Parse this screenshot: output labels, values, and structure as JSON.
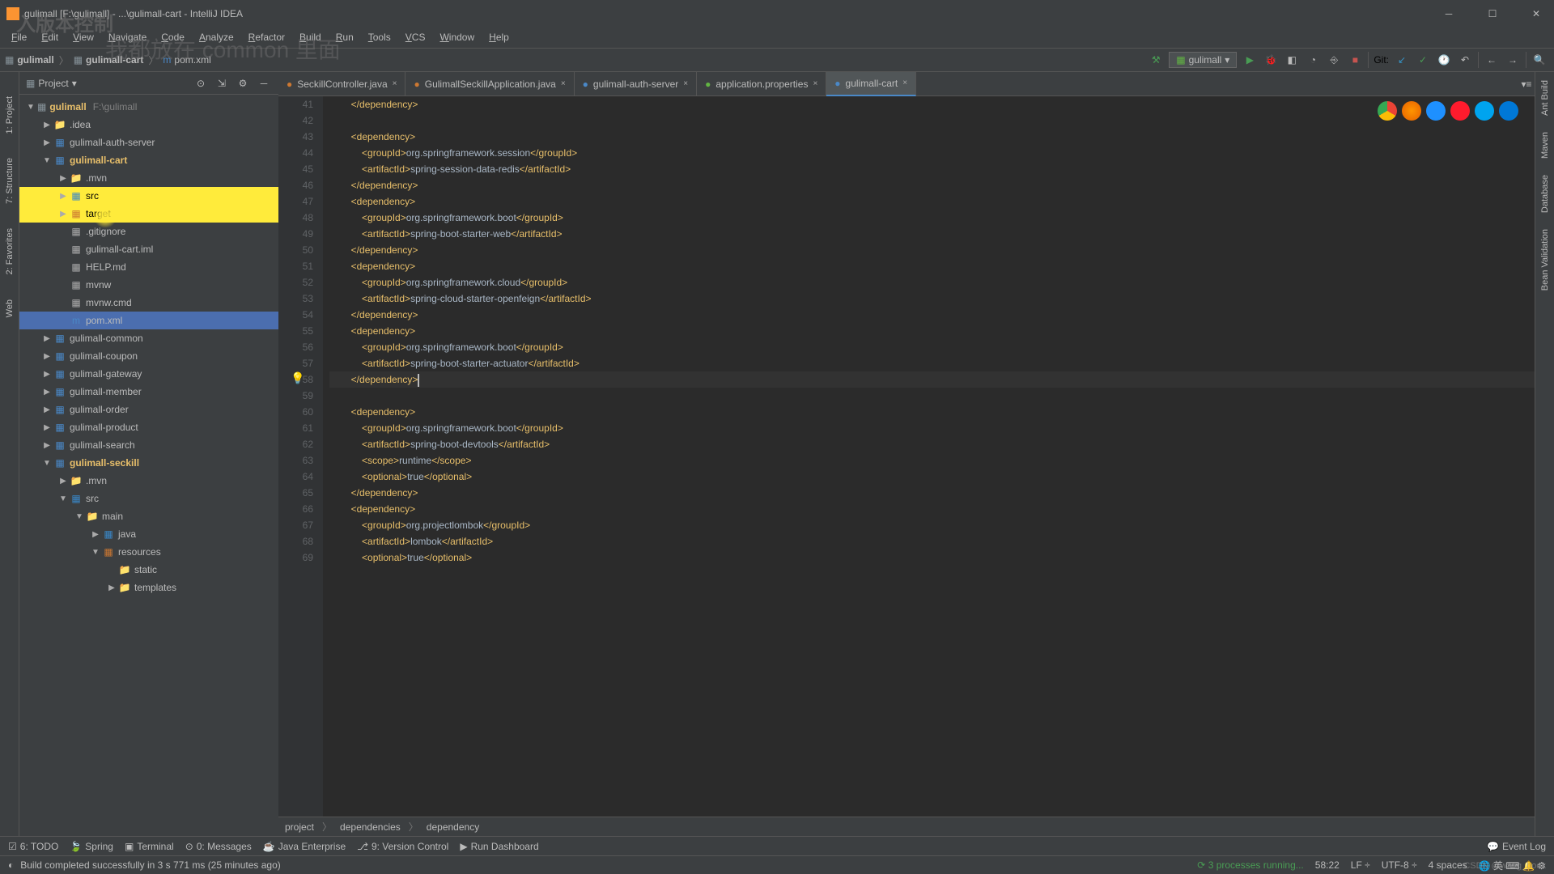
{
  "watermark1": "入版本控制",
  "watermark2": "我都放在 common 里面",
  "title": "gulimall [F:\\gulimall] - ...\\gulimall-cart - IntelliJ IDEA",
  "menu": [
    "File",
    "Edit",
    "View",
    "Navigate",
    "Code",
    "Analyze",
    "Refactor",
    "Build",
    "Run",
    "Tools",
    "VCS",
    "Window",
    "Help"
  ],
  "breadcrumb": {
    "root": "gulimall",
    "module": "gulimall-cart",
    "file": "pom.xml"
  },
  "run_config": "gulimall",
  "git_label": "Git:",
  "panel": {
    "name": "Project"
  },
  "tree": {
    "root": "gulimall",
    "root_path": "F:\\gulimall",
    "items": [
      {
        "indent": 1,
        "chevron": "▶",
        "icon": "folder",
        "label": ".idea"
      },
      {
        "indent": 1,
        "chevron": "▶",
        "icon": "module",
        "label": "gulimall-auth-server"
      },
      {
        "indent": 1,
        "chevron": "▼",
        "icon": "module",
        "label": "gulimall-cart",
        "bold": true
      },
      {
        "indent": 2,
        "chevron": "▶",
        "icon": "folder",
        "label": ".mvn"
      },
      {
        "indent": 2,
        "chevron": "▶",
        "icon": "src",
        "label": "src",
        "highlight": true
      },
      {
        "indent": 2,
        "chevron": "▶",
        "icon": "target",
        "label": "target",
        "highlight": true
      },
      {
        "indent": 2,
        "chevron": "",
        "icon": "file",
        "label": ".gitignore"
      },
      {
        "indent": 2,
        "chevron": "",
        "icon": "file",
        "label": "gulimall-cart.iml"
      },
      {
        "indent": 2,
        "chevron": "",
        "icon": "file",
        "label": "HELP.md"
      },
      {
        "indent": 2,
        "chevron": "",
        "icon": "file",
        "label": "mvnw"
      },
      {
        "indent": 2,
        "chevron": "",
        "icon": "file",
        "label": "mvnw.cmd"
      },
      {
        "indent": 2,
        "chevron": "",
        "icon": "maven",
        "label": "pom.xml",
        "selected": true
      },
      {
        "indent": 1,
        "chevron": "▶",
        "icon": "module",
        "label": "gulimall-common"
      },
      {
        "indent": 1,
        "chevron": "▶",
        "icon": "module",
        "label": "gulimall-coupon"
      },
      {
        "indent": 1,
        "chevron": "▶",
        "icon": "module",
        "label": "gulimall-gateway"
      },
      {
        "indent": 1,
        "chevron": "▶",
        "icon": "module",
        "label": "gulimall-member"
      },
      {
        "indent": 1,
        "chevron": "▶",
        "icon": "module",
        "label": "gulimall-order"
      },
      {
        "indent": 1,
        "chevron": "▶",
        "icon": "module",
        "label": "gulimall-product"
      },
      {
        "indent": 1,
        "chevron": "▶",
        "icon": "module",
        "label": "gulimall-search"
      },
      {
        "indent": 1,
        "chevron": "▼",
        "icon": "module",
        "label": "gulimall-seckill",
        "bold": true
      },
      {
        "indent": 2,
        "chevron": "▶",
        "icon": "folder",
        "label": ".mvn"
      },
      {
        "indent": 2,
        "chevron": "▼",
        "icon": "src",
        "label": "src"
      },
      {
        "indent": 3,
        "chevron": "▼",
        "icon": "folder",
        "label": "main"
      },
      {
        "indent": 4,
        "chevron": "▶",
        "icon": "src",
        "label": "java"
      },
      {
        "indent": 4,
        "chevron": "▼",
        "icon": "res",
        "label": "resources"
      },
      {
        "indent": 5,
        "chevron": "",
        "icon": "folder",
        "label": "static"
      },
      {
        "indent": 5,
        "chevron": "▶",
        "icon": "folder",
        "label": "templates"
      }
    ]
  },
  "tabs": [
    {
      "icon": "java",
      "label": "SeckillController.java",
      "closable": true
    },
    {
      "icon": "java",
      "label": "GulimallSeckillApplication.java",
      "closable": true
    },
    {
      "icon": "maven",
      "label": "gulimall-auth-server",
      "closable": true
    },
    {
      "icon": "prop",
      "label": "application.properties",
      "closable": true
    },
    {
      "icon": "maven",
      "label": "gulimall-cart",
      "active": true,
      "closable": true
    }
  ],
  "lines": [
    {
      "n": 41,
      "t": "        </dependency>"
    },
    {
      "n": 42,
      "t": ""
    },
    {
      "n": 43,
      "t": "        <dependency>"
    },
    {
      "n": 44,
      "t": "            <groupId>org.springframework.session</groupId>"
    },
    {
      "n": 45,
      "t": "            <artifactId>spring-session-data-redis</artifactId>"
    },
    {
      "n": 46,
      "t": "        </dependency>"
    },
    {
      "n": 47,
      "t": "        <dependency>"
    },
    {
      "n": 48,
      "t": "            <groupId>org.springframework.boot</groupId>"
    },
    {
      "n": 49,
      "t": "            <artifactId>spring-boot-starter-web</artifactId>"
    },
    {
      "n": 50,
      "t": "        </dependency>"
    },
    {
      "n": 51,
      "t": "        <dependency>"
    },
    {
      "n": 52,
      "t": "            <groupId>org.springframework.cloud</groupId>"
    },
    {
      "n": 53,
      "t": "            <artifactId>spring-cloud-starter-openfeign</artifactId>"
    },
    {
      "n": 54,
      "t": "        </dependency>"
    },
    {
      "n": 55,
      "t": "        <dependency>"
    },
    {
      "n": 56,
      "t": "            <groupId>org.springframework.boot</groupId>"
    },
    {
      "n": 57,
      "t": "            <artifactId>spring-boot-starter-actuator</artifactId>"
    },
    {
      "n": 58,
      "t": "        </dependency>",
      "caret": true
    },
    {
      "n": 59,
      "t": ""
    },
    {
      "n": 60,
      "t": "        <dependency>"
    },
    {
      "n": 61,
      "t": "            <groupId>org.springframework.boot</groupId>"
    },
    {
      "n": 62,
      "t": "            <artifactId>spring-boot-devtools</artifactId>"
    },
    {
      "n": 63,
      "t": "            <scope>runtime</scope>"
    },
    {
      "n": 64,
      "t": "            <optional>true</optional>"
    },
    {
      "n": 65,
      "t": "        </dependency>"
    },
    {
      "n": 66,
      "t": "        <dependency>"
    },
    {
      "n": 67,
      "t": "            <groupId>org.projectlombok</groupId>"
    },
    {
      "n": 68,
      "t": "            <artifactId>lombok</artifactId>"
    },
    {
      "n": 69,
      "t": "            <optional>true</optional>"
    }
  ],
  "struct_breadcrumb": [
    "project",
    "dependencies",
    "dependency"
  ],
  "bottom_tools": [
    {
      "icon": "☑",
      "label": "6: TODO"
    },
    {
      "icon": "🍃",
      "label": "Spring"
    },
    {
      "icon": "▣",
      "label": "Terminal"
    },
    {
      "icon": "⊙",
      "label": "0: Messages"
    },
    {
      "icon": "☕",
      "label": "Java Enterprise"
    },
    {
      "icon": "⎇",
      "label": "9: Version Control"
    },
    {
      "icon": "▶",
      "label": "Run Dashboard"
    }
  ],
  "event_log": "Event Log",
  "status": {
    "build": "Build completed successfully in 3 s 771 ms (25 minutes ago)",
    "processes": "3 processes running...",
    "pos": "58:22",
    "lf": "LF",
    "enc": "UTF-8",
    "spaces": "4 spaces"
  },
  "left_stripe": [
    "1: Project",
    "7: Structure",
    "2: Favorites",
    "Web"
  ],
  "right_stripe": [
    "Ant Build",
    "Maven",
    "Database",
    "Bean Validation"
  ],
  "csdn": "CSDN @wang_book"
}
